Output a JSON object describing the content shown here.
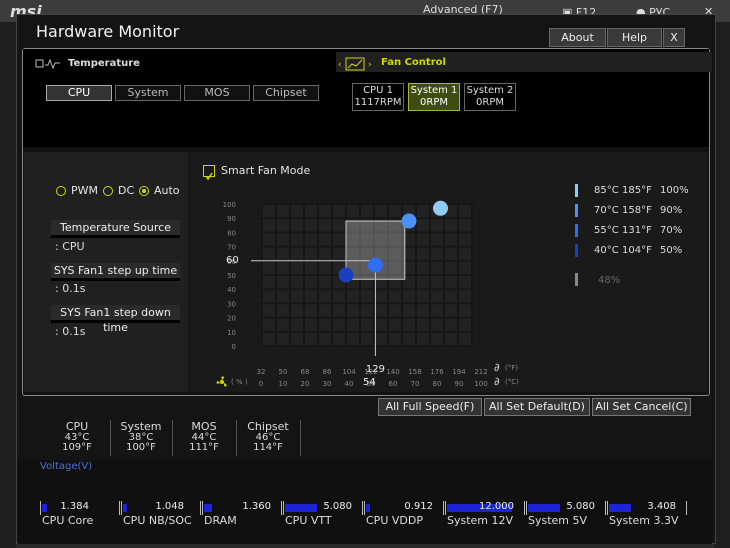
{
  "backdrop": {
    "advanced_label": "Advanced (F7)",
    "f12_label": "F12",
    "lang_label": "РУС",
    "close_glyph": "✕"
  },
  "window": {
    "title": "Hardware Monitor",
    "about_label": "About",
    "help_label": "Help",
    "close_label": "X"
  },
  "temperature": {
    "section_label": "Temperature",
    "tabs": [
      "CPU",
      "System",
      "MOS",
      "Chipset"
    ],
    "active_tab": 0
  },
  "fan_control": {
    "section_label": "Fan Control",
    "fans": [
      {
        "name": "CPU 1",
        "rpm": "1117RPM"
      },
      {
        "name": "System 1",
        "rpm": "0RPM"
      },
      {
        "name": "System 2",
        "rpm": "0RPM"
      }
    ],
    "active_fan": 1
  },
  "mode": {
    "options": [
      "PWM",
      "DC",
      "Auto"
    ],
    "selected": 2
  },
  "left_panel": {
    "temp_source_label": "Temperature Source",
    "temp_source_value": ": CPU",
    "step_up_label": "SYS Fan1 step up time",
    "step_up_value": ": 0.1s",
    "step_down_label": "SYS Fan1 step down time",
    "step_down_value": ": 0.1s"
  },
  "smart_fan": {
    "label": "Smart Fan Mode",
    "checked": true
  },
  "chart_data": {
    "type": "scatter",
    "y_ticks": [
      "100",
      "90",
      "80",
      "70",
      "60",
      "50",
      "40",
      "30",
      "20",
      "10",
      "0"
    ],
    "x_ticks_f": [
      "32",
      "50",
      "68",
      "86",
      "104",
      "122",
      "140",
      "158",
      "176",
      "194",
      "212"
    ],
    "x_ticks_c": [
      "0",
      "10",
      "20",
      "30",
      "40",
      "50",
      "60",
      "70",
      "80",
      "90",
      "100"
    ],
    "ylim": [
      0,
      100
    ],
    "xlim": [
      0,
      100
    ],
    "x_unit_f": "(°F)",
    "x_unit_c": "(°C)",
    "y_unit": "( % )",
    "points": [
      {
        "x": 40,
        "y": 50,
        "color": "#1a3fbf"
      },
      {
        "x": 54,
        "y": 57,
        "color": "#2e6ef0"
      },
      {
        "x": 70,
        "y": 88,
        "color": "#4a90f5"
      },
      {
        "x": 85,
        "y": 97,
        "color": "#8ecbf5"
      }
    ],
    "selected_point": {
      "x": 54,
      "y": 60
    },
    "selected_y_label": "60",
    "selected_x_f_label": "129",
    "selected_x_c_label": "54"
  },
  "legend": [
    {
      "c": "85°C",
      "f": "185°F",
      "pct": "100%",
      "color": "#8ecbf5"
    },
    {
      "c": "70°C",
      "f": "158°F",
      "pct": "90%",
      "color": "#4a90f5"
    },
    {
      "c": "55°C",
      "f": "131°F",
      "pct": "70%",
      "color": "#2e6ef0"
    },
    {
      "c": "40°C",
      "f": "104°F",
      "pct": "50%",
      "color": "#1a3fbf"
    }
  ],
  "legend_min": {
    "pct": "48%",
    "color": "#888888"
  },
  "actions": {
    "full_speed": "All Full Speed(F)",
    "set_default": "All Set Default(D)",
    "set_cancel": "All Set Cancel(C)"
  },
  "readings": [
    {
      "name": "CPU",
      "c": "43°C",
      "f": "109°F"
    },
    {
      "name": "System",
      "c": "38°C",
      "f": "100°F"
    },
    {
      "name": "MOS",
      "c": "44°C",
      "f": "111°F"
    },
    {
      "name": "Chipset",
      "c": "46°C",
      "f": "114°F"
    }
  ],
  "voltage": {
    "title": "Voltage(V)",
    "items": [
      {
        "name": "CPU Core",
        "value": "1.384",
        "fill": 0.06
      },
      {
        "name": "CPU NB/SOC",
        "value": "1.048",
        "fill": 0.05
      },
      {
        "name": "DRAM",
        "value": "1.360",
        "fill": 0.1
      },
      {
        "name": "CPU VTT",
        "value": "5.080",
        "fill": 0.42
      },
      {
        "name": "CPU VDDP",
        "value": "0.912",
        "fill": 0.05
      },
      {
        "name": "System 12V",
        "value": "12.000",
        "fill": 0.85
      },
      {
        "name": "System 5V",
        "value": "5.080",
        "fill": 0.42
      },
      {
        "name": "System 3.3V",
        "value": "3.408",
        "fill": 0.28
      }
    ]
  },
  "colors": {
    "accent_yellow": "#cfd800",
    "active_fan_bg": "#3f4d10"
  }
}
